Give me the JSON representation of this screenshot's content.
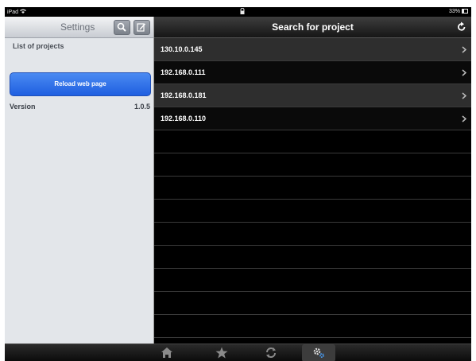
{
  "status_bar": {
    "device": "iPad",
    "battery": "33%"
  },
  "settings": {
    "title": "Settings",
    "section_label": "List of projects",
    "reload_label": "Reload web page",
    "version_label": "Version",
    "version_value": "1.0.5"
  },
  "project_search": {
    "title": "Search for project",
    "projects": [
      "130.10.0.145",
      "192.168.0.111",
      "192.168.0.181",
      "192.168.0.110"
    ]
  },
  "tab_bar": {
    "icons": [
      "home-icon",
      "star-icon",
      "sync-icon",
      "gear-icon"
    ],
    "active": "gear-icon"
  },
  "colors": {
    "accent_blue": "#2a6ae8",
    "list_row": "#2e2e2e"
  }
}
